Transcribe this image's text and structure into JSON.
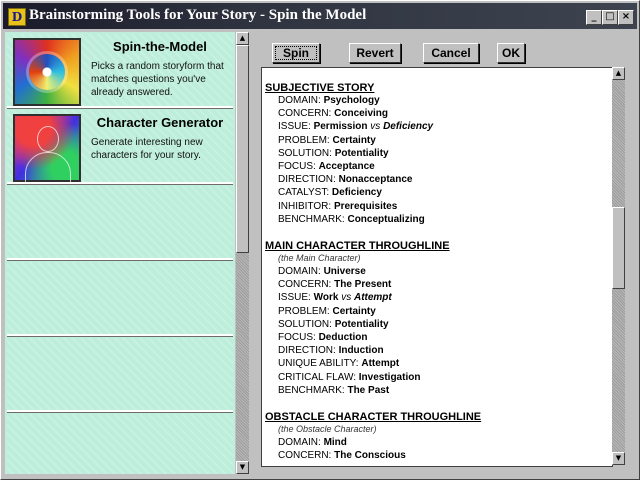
{
  "window": {
    "app_icon": "D",
    "title": "Brainstorming Tools for Your Story - Spin the Model",
    "controls": {
      "minimize": "_",
      "maximize": "□",
      "close": "×"
    }
  },
  "tools": [
    {
      "title": "Spin-the-Model",
      "description": "Picks a random storyform that matches questions you've already answered."
    },
    {
      "title": "Character Generator",
      "description": "Generate interesting new characters for your story."
    }
  ],
  "buttons": {
    "spin": "Spin",
    "revert": "Revert",
    "cancel": "Cancel",
    "ok": "OK"
  },
  "report": {
    "sections": [
      {
        "heading": "SUBJECTIVE STORY",
        "note": "",
        "rows": [
          {
            "label": "DOMAIN:",
            "value": "Psychology"
          },
          {
            "label": "CONCERN:",
            "value": "Conceiving"
          },
          {
            "label": "ISSUE:",
            "value": "Permission",
            "vs": "vs",
            "value2": "Deficiency"
          },
          {
            "label": "PROBLEM:",
            "value": "Certainty"
          },
          {
            "label": "SOLUTION:",
            "value": "Potentiality"
          },
          {
            "label": "FOCUS:",
            "value": "Acceptance"
          },
          {
            "label": "DIRECTION:",
            "value": "Nonacceptance"
          },
          {
            "label": "CATALYST:",
            "value": "Deficiency"
          },
          {
            "label": "INHIBITOR:",
            "value": "Prerequisites"
          },
          {
            "label": "BENCHMARK:",
            "value": "Conceptualizing"
          }
        ]
      },
      {
        "heading": "MAIN CHARACTER THROUGHLINE",
        "note": "(the Main Character)",
        "rows": [
          {
            "label": "DOMAIN:",
            "value": "Universe"
          },
          {
            "label": "CONCERN:",
            "value": "The Present"
          },
          {
            "label": "ISSUE:",
            "value": "Work",
            "vs": "vs",
            "value2": "Attempt"
          },
          {
            "label": "PROBLEM:",
            "value": "Certainty"
          },
          {
            "label": "SOLUTION:",
            "value": "Potentiality"
          },
          {
            "label": "FOCUS:",
            "value": "Deduction"
          },
          {
            "label": "DIRECTION:",
            "value": "Induction"
          },
          {
            "label": "UNIQUE ABILITY:",
            "value": "Attempt"
          },
          {
            "label": "CRITICAL FLAW:",
            "value": "Investigation"
          },
          {
            "label": "BENCHMARK:",
            "value": "The Past"
          }
        ]
      },
      {
        "heading": "OBSTACLE CHARACTER THROUGHLINE",
        "note": "(the Obstacle Character)",
        "rows": [
          {
            "label": "DOMAIN:",
            "value": "Mind"
          },
          {
            "label": "CONCERN:",
            "value": "The Conscious"
          }
        ]
      }
    ]
  }
}
